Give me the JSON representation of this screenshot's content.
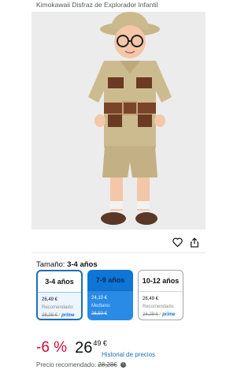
{
  "product": {
    "title": "Kimokawaii Disfraz de Explorador Infantil"
  },
  "image": {
    "alt": "Niño con disfraz de explorador"
  },
  "actions": {
    "favorite_icon": "heart-icon",
    "share_icon": "share-icon"
  },
  "size": {
    "label": "Tamaño:",
    "selected": "3-4 años"
  },
  "options": [
    {
      "name": "3-4 años",
      "price": "26,49 €",
      "note": "Recomendado:",
      "old_price": "28,28 €",
      "prime": "prime",
      "selected": true
    },
    {
      "name": "7-9 años",
      "price": "24,10 €",
      "note": "Mediano:",
      "old_price": "26,50 €",
      "prime": "",
      "selected": false
    },
    {
      "name": "10-12 años",
      "price": "26,49 €",
      "note": "Recomendado:",
      "old_price": "28,28 €",
      "prime": "prime",
      "selected": false
    }
  ],
  "price": {
    "discount": "-6 %",
    "whole": "26",
    "cents": "49 €",
    "history_link": "Historial de precios",
    "recommended_label": "Precio recomendado:",
    "recommended_value": "28,28€"
  },
  "colors": {
    "link": "#1b6fb8",
    "discount": "#cc0c39",
    "selected_border": "#1e6fb4",
    "highlight_bg": "#2a8be6"
  }
}
